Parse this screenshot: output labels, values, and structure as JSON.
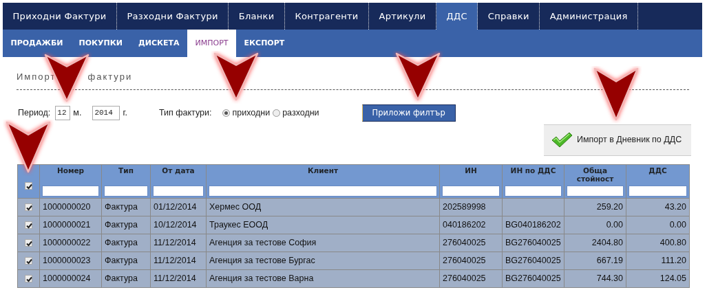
{
  "main_nav": [
    {
      "label": "Приходни Фактури",
      "selected": false
    },
    {
      "label": "Разходни Фактури",
      "selected": false
    },
    {
      "label": "Бланки",
      "selected": false
    },
    {
      "label": "Контрагенти",
      "selected": false
    },
    {
      "label": "Артикули",
      "selected": false
    },
    {
      "label": "ДДС",
      "selected": true
    },
    {
      "label": "Справки",
      "selected": false
    },
    {
      "label": "Администрация",
      "selected": false
    }
  ],
  "sub_nav": [
    {
      "label": "ПРОДАЖБИ",
      "selected": false
    },
    {
      "label": "ПОКУПКИ",
      "selected": false
    },
    {
      "label": "ДИСКЕТА",
      "selected": false
    },
    {
      "label": "ИМПОРТ",
      "selected": true
    },
    {
      "label": "ЕКСПОРТ",
      "selected": false
    }
  ],
  "title_parts": [
    "Импорт",
    "фактури"
  ],
  "filter": {
    "period_label": "Период:",
    "month": "12",
    "month_unit": "м.",
    "year": "2014",
    "year_unit": "г.",
    "type_label": "Тип фактури:",
    "types": [
      {
        "label": "приходни",
        "selected": true
      },
      {
        "label": "разходни",
        "selected": false
      }
    ],
    "apply_button": "Приложи филтър"
  },
  "import_button": "Импорт в Дневник по ДДС",
  "table": {
    "select_all_checked": true,
    "columns": [
      {
        "label": "Номер"
      },
      {
        "label": "Тип"
      },
      {
        "label": "От дата"
      },
      {
        "label": "Клиент"
      },
      {
        "label": "ИН"
      },
      {
        "label": "ИН по ДДС"
      },
      {
        "label": "Обща стойност"
      },
      {
        "label": "ДДС"
      }
    ],
    "rows": [
      {
        "checked": true,
        "cells": [
          "1000000020",
          "Фактура",
          "01/12/2014",
          "Хермес ООД",
          "202589998",
          "",
          "259.20",
          "43.20"
        ]
      },
      {
        "checked": true,
        "cells": [
          "1000000021",
          "Фактура",
          "10/12/2014",
          "Траукес ЕООД",
          "040186202",
          "BG040186202",
          "0.00",
          "0.00"
        ]
      },
      {
        "checked": true,
        "cells": [
          "1000000022",
          "Фактура",
          "11/12/2014",
          "Агенция за тестове София",
          "276040025",
          "BG276040025",
          "2404.80",
          "400.80"
        ]
      },
      {
        "checked": true,
        "cells": [
          "1000000023",
          "Фактура",
          "11/12/2014",
          "Агенция за тестове Бургас",
          "276040025",
          "BG276040025",
          "667.19",
          "111.20"
        ]
      },
      {
        "checked": true,
        "cells": [
          "1000000024",
          "Фактура",
          "11/12/2014",
          "Агенция за тестове Варна",
          "276040025",
          "BG276040025",
          "744.30",
          "124.05"
        ]
      }
    ]
  }
}
